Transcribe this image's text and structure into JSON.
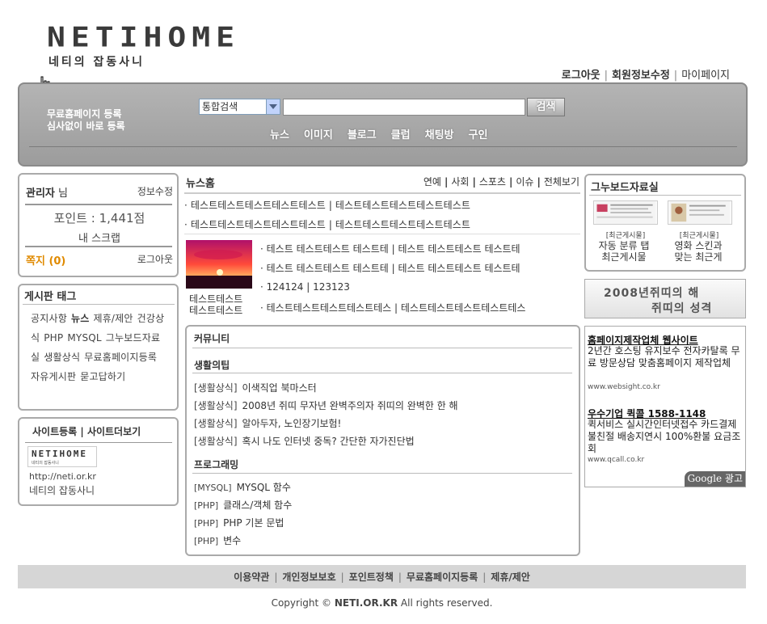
{
  "logo": {
    "title": "NETIHOME",
    "subtitle": "네티의 잡동사니"
  },
  "top_links": {
    "logout": "로그아웃",
    "edit_profile": "회원정보수정",
    "mypage": "마이페이지"
  },
  "header": {
    "register_line1": "무료홈페이지 등록",
    "register_line2": "심사없이 바로 등록",
    "search_select": "통합검색",
    "search_button": "검색",
    "categories": [
      "뉴스",
      "이미지",
      "블로그",
      "클럽",
      "채팅방",
      "구인"
    ]
  },
  "user": {
    "name": "관리자",
    "honorific": "님",
    "edit": "정보수정",
    "points": "포인트 : 1,441점",
    "scrap": "내 스크랩",
    "notes": "쪽지 (0)",
    "logout": "로그아웃"
  },
  "tags": {
    "title": "게시판 태그",
    "items": [
      "공지사항",
      "뉴스",
      "제휴/제안",
      "건강상식",
      "PHP",
      "MYSQL",
      "그누보드자료실",
      "생활상식",
      "무료홈페이지등록",
      "자유게시판",
      "묻고답하기"
    ]
  },
  "site": {
    "title": "사이트등록 | 사이트더보기",
    "logo_text": "NETIHOME",
    "logo_sub": "네티의 잡동사니",
    "url": "http://neti.or.kr",
    "name": "네티의 잡동사니"
  },
  "news": {
    "title": "뉴스홈",
    "tabs": [
      "연예",
      "사회",
      "스포츠",
      "이슈",
      "전체보기"
    ],
    "lines": [
      "· 테스트테스트테스트테스트테스트 | 테스트테스트테스트테스트테스트",
      "· 테스트테스트테스트테스트테스트 | 테스트테스트테스트테스트테스트"
    ],
    "photo_caption1": "테스트테스트",
    "photo_caption2": "테스트테스트",
    "sub_lines": [
      "· 테스트 테스트테스트 테스트테 | 테스트 테스트테스트 테스트테",
      "· 테스트 테스트테스트 테스트테 | 테스트 테스트테스트 테스트테",
      "· 124124 | 123123",
      "· 테스트테스트테스트테스트테스 | 테스트테스트테스트테스트테스"
    ]
  },
  "community": {
    "title": "커뮤니티",
    "life": {
      "title": "생활의팁",
      "items": [
        {
          "cat": "[생활상식]",
          "text": "이색직업 북마스터"
        },
        {
          "cat": "[생활상식]",
          "text": "2008년 쥐띠 무자년 완벽주의자 쥐띠의 완벽한 한 해"
        },
        {
          "cat": "[생활상식]",
          "text": "알아두자, 노인장기보험!"
        },
        {
          "cat": "[생활상식]",
          "text": "혹시 나도 인터넷 중독? 간단한 자가진단법"
        }
      ]
    },
    "programming": {
      "title": "프로그래밍",
      "items": [
        {
          "cat": "[MYSQL]",
          "text": "MYSQL 함수"
        },
        {
          "cat": "[PHP]",
          "text": "클래스/객체 함수"
        },
        {
          "cat": "[PHP]",
          "text": "PHP 기본 문법"
        },
        {
          "cat": "[PHP]",
          "text": "변수"
        }
      ]
    }
  },
  "board": {
    "title": "그누보드자료실",
    "items": [
      {
        "cap": "[최근게시물]",
        "title1": "자동 분류 탭",
        "title2": "최근게시물"
      },
      {
        "cap": "[최근게시물]",
        "title1": "영화 스킨과",
        "title2": "맞는 최근게"
      }
    ]
  },
  "banner": {
    "line1": "2008년쥐띠의 해",
    "line2": "쥐띠의 성격"
  },
  "ads": [
    {
      "head": "홈페이지제작업체 웹사이트",
      "body": "2년간 호스팅 유지보수 전자카탈록 무료 방문상담 맞춤홈페이지 제작업체",
      "url": "www.websight.co.kr"
    },
    {
      "head": "우수기업 퀵콜 1588-1148",
      "body": "퀵서비스 실시간인터넷접수 카드결제 불친절 배송지연시 100%환불 요금조회",
      "url": "www.qcall.co.kr"
    }
  ],
  "google_badge": "Google 광고",
  "footer": {
    "links": [
      "이용약관",
      "개인정보보호",
      "포인트정책",
      "무료홈페이지등록",
      "제휴/제안"
    ],
    "copyright_prefix": "Copyright ©",
    "copyright_site": "NETI.OR.KR",
    "copyright_suffix": "All rights reserved."
  }
}
